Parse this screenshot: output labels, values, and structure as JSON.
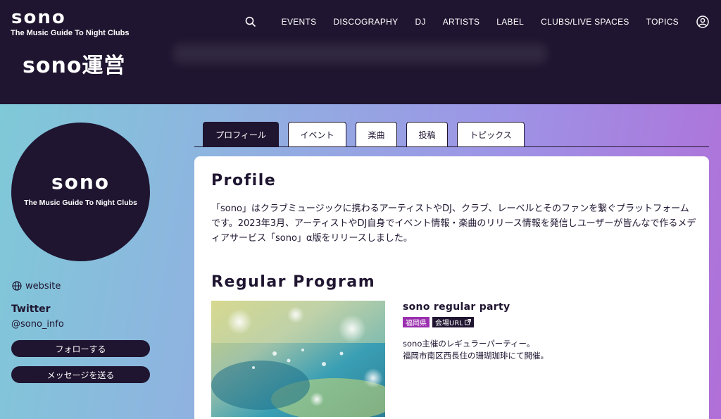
{
  "header": {
    "logo_main": "sono",
    "logo_sub": "The Music Guide To Night Clubs",
    "page_title": "sono運営"
  },
  "nav": {
    "items": [
      "EVENTS",
      "DISCOGRAPHY",
      "DJ",
      "ARTISTS",
      "LABEL",
      "CLUBS/LIVE SPACES",
      "TOPICS"
    ],
    "search_icon": "search-icon",
    "user_icon": "user-circle-icon"
  },
  "sidebar": {
    "avatar_title": "sono",
    "avatar_sub": "The Music Guide To Night Clubs",
    "website_label": "website",
    "twitter_label": "Twitter",
    "twitter_handle": "@sono_info",
    "follow_button": "フォローする",
    "message_button": "メッセージを送る"
  },
  "tabs": [
    "プロフィール",
    "イベント",
    "楽曲",
    "投稿",
    "トピックス"
  ],
  "active_tab": "プロフィール",
  "profile": {
    "heading": "Profile",
    "text": "「sono」はクラブミュージックに携わるアーティストやDJ、クラブ、レーベルとそのファンを繋ぐプラットフォームです。2023年3月、アーティストやDJ自身でイベント情報・楽曲のリリース情報を発信しユーザーが皆んなで作るメディアサービス「sono」α版をリリースしました。"
  },
  "regular_program": {
    "heading": "Regular Program",
    "title": "sono regular party",
    "badge_prefecture": "福岡県",
    "badge_url": "会場URL",
    "desc_line1": "sono主催のレギュラーパーティー。",
    "desc_line2": "福岡市南区西長住の珊瑚珈琲にて開催。"
  },
  "colors": {
    "dark": "#1f1530",
    "badge_purple": "#9a2fae",
    "gradient_start": "#7fc9d8",
    "gradient_end": "#b06fd8"
  }
}
